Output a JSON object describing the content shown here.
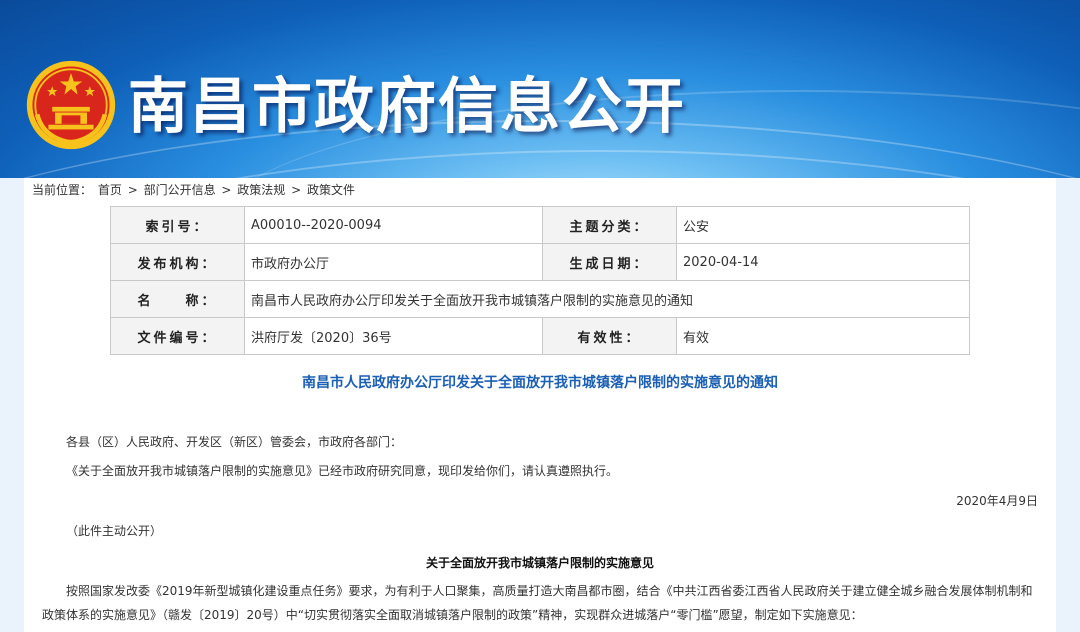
{
  "site_title": "南昌市政府信息公开",
  "breadcrumb": {
    "prefix": "当前位置：",
    "items": [
      "首页",
      "部门公开信息",
      "政策法规",
      "政策文件"
    ],
    "sep": " > "
  },
  "meta": {
    "index_label": "索引号：",
    "index_value": "A00010--2020-0094",
    "category_label": "主题分类：",
    "category_value": "公安",
    "issuer_label": "发布机构：",
    "issuer_value": "市政府办公厅",
    "date_label": "生成日期：",
    "date_value": "2020-04-14",
    "name_label": "名　　称：",
    "name_value": "南昌市人民政府办公厅印发关于全面放开我市城镇落户限制的实施意见的通知",
    "docno_label": "文件编号：",
    "docno_value": "洪府厅发〔2020〕36号",
    "valid_label": "有效性：",
    "valid_value": "有效"
  },
  "doc": {
    "title": "南昌市人民政府办公厅印发关于全面放开我市城镇落户限制的实施意见的通知",
    "addressee": "各县（区）人民政府、开发区（新区）管委会，市政府各部门：",
    "body1": "《关于全面放开我市城镇落户限制的实施意见》已经市政府研究同意，现印发给你们，请认真遵照执行。",
    "date": "2020年4月9日",
    "note": "（此件主动公开）",
    "sub_title": "关于全面放开我市城镇落户限制的实施意见",
    "para_line1": "按照国家发改委《2019年新型城镇化建设重点任务》要求，为有利于人口聚集，高质量打造大南昌都市圈，结合《中共江西省委江西省人民政府关于建立健全城乡融合发展体制机制和",
    "para_line2": "政策体系的实施意见》（赣发〔2019〕20号）中“切实贯彻落实全面取消城镇落户限制的政策”精神，实现群众进城落户“零门槛”愿望，制定如下实施意见："
  },
  "colors": {
    "banner": "#0e5fb8",
    "title_blue": "#1a5fb4",
    "emblem_red": "#d8261c",
    "emblem_gold": "#f6c21b"
  }
}
